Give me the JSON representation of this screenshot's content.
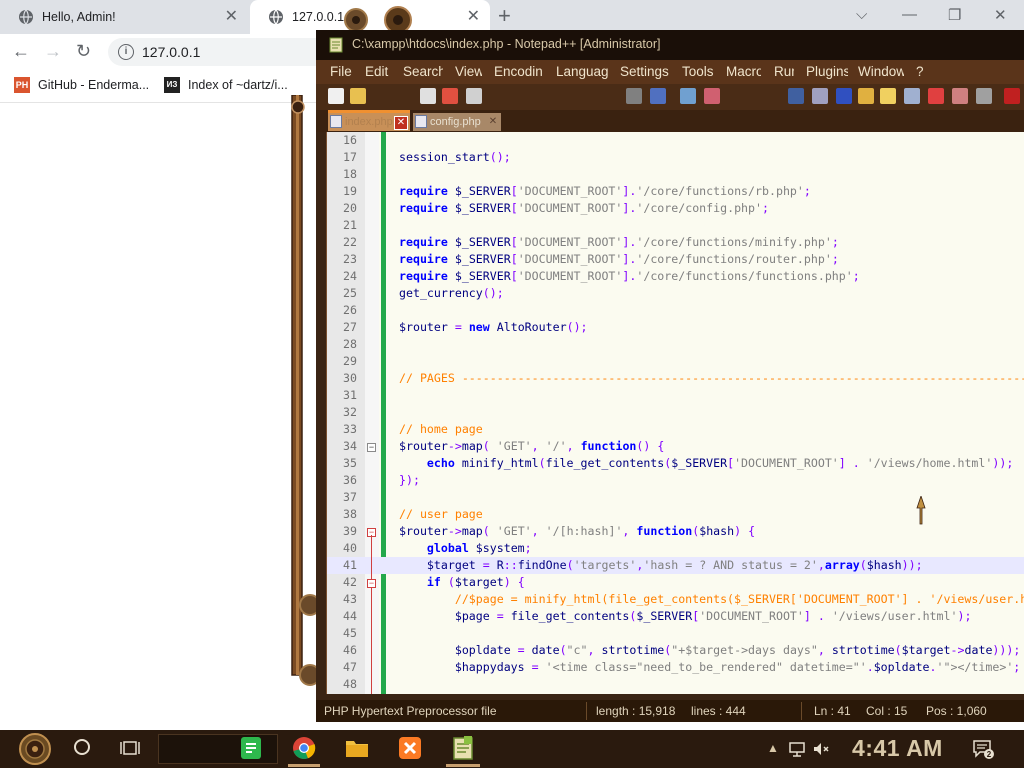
{
  "browser": {
    "tabs": [
      {
        "title": "Hello, Admin!",
        "active": false
      },
      {
        "title": "127.0.0.1",
        "active": true
      }
    ],
    "address": "127.0.0.1",
    "bookmarks": [
      {
        "label": "GitHub - Enderma...",
        "icon_text": "PH"
      },
      {
        "label": "Index of ~dartz/i...",
        "icon_text": "ИЗ"
      }
    ]
  },
  "notepad": {
    "title": "C:\\xampp\\htdocs\\index.php - Notepad++ [Administrator]",
    "menu": [
      "File",
      "Edit",
      "Search",
      "View",
      "Encoding",
      "Language",
      "Settings",
      "Tools",
      "Macro",
      "Run",
      "Plugins",
      "Window",
      "?"
    ],
    "file_tabs": [
      {
        "label": "index.php",
        "active": true
      },
      {
        "label": "config.php",
        "active": false
      }
    ],
    "current_line": 41,
    "lines": [
      {
        "n": 16,
        "code": ""
      },
      {
        "n": 17,
        "code": "session_start();"
      },
      {
        "n": 18,
        "code": ""
      },
      {
        "n": 19,
        "code": "require $_SERVER['DOCUMENT_ROOT'].'/core/functions/rb.php';"
      },
      {
        "n": 20,
        "code": "require $_SERVER['DOCUMENT_ROOT'].'/core/config.php';"
      },
      {
        "n": 21,
        "code": ""
      },
      {
        "n": 22,
        "code": "require $_SERVER['DOCUMENT_ROOT'].'/core/functions/minify.php';"
      },
      {
        "n": 23,
        "code": "require $_SERVER['DOCUMENT_ROOT'].'/core/functions/router.php';"
      },
      {
        "n": 24,
        "code": "require $_SERVER['DOCUMENT_ROOT'].'/core/functions/functions.php';"
      },
      {
        "n": 25,
        "code": "get_currency();"
      },
      {
        "n": 26,
        "code": ""
      },
      {
        "n": 27,
        "code": "$router = new AltoRouter();"
      },
      {
        "n": 28,
        "code": ""
      },
      {
        "n": 29,
        "code": ""
      },
      {
        "n": 30,
        "code": "// PAGES ---------------------------------------------------------------------------------------"
      },
      {
        "n": 31,
        "code": ""
      },
      {
        "n": 32,
        "code": ""
      },
      {
        "n": 33,
        "code": "// home page"
      },
      {
        "n": 34,
        "code": "$router->map( 'GET', '/', function() {"
      },
      {
        "n": 35,
        "code": "    echo minify_html(file_get_contents($_SERVER['DOCUMENT_ROOT'] . '/views/home.html'));"
      },
      {
        "n": 36,
        "code": "});"
      },
      {
        "n": 37,
        "code": ""
      },
      {
        "n": 38,
        "code": "// user page"
      },
      {
        "n": 39,
        "code": "$router->map( 'GET', '/[h:hash]', function($hash) {"
      },
      {
        "n": 40,
        "code": "    global $system;"
      },
      {
        "n": 41,
        "code": "    $target = R::findOne('targets','hash = ? AND status = 2',array($hash));"
      },
      {
        "n": 42,
        "code": "    if ($target) {"
      },
      {
        "n": 43,
        "code": "        //$page = minify_html(file_get_contents($_SERVER['DOCUMENT_ROOT'] . '/views/user.html'));"
      },
      {
        "n": 44,
        "code": "        $page = file_get_contents($_SERVER['DOCUMENT_ROOT'] . '/views/user.html');"
      },
      {
        "n": 45,
        "code": ""
      },
      {
        "n": 46,
        "code": "        $opldate = date(\"c\", strtotime(\"+$target->days days\", strtotime($target->date)));"
      },
      {
        "n": 47,
        "code": "        $happydays = '<time class=\"need_to_be_rendered\" datetime=\"'.$opldate.'\"></time>';"
      },
      {
        "n": 48,
        "code": ""
      }
    ],
    "status": {
      "type": "PHP Hypertext Preprocessor file",
      "length": "length : 15,918",
      "lines": "lines : 444",
      "ln": "Ln : 41",
      "col": "Col : 15",
      "pos": "Pos : 1,060"
    }
  },
  "taskbar": {
    "clock": "4:41 AM",
    "notifications": "2"
  },
  "colors": {
    "npp_frame": "#3a2414",
    "npp_menu": "#5a341a",
    "editor_bg": "#fbfbf0",
    "keyword": "#0000ff",
    "string": "#808080",
    "comment": "#ff8000",
    "change_bar": "#23a84b",
    "taskbar": "#2a1a0e"
  }
}
